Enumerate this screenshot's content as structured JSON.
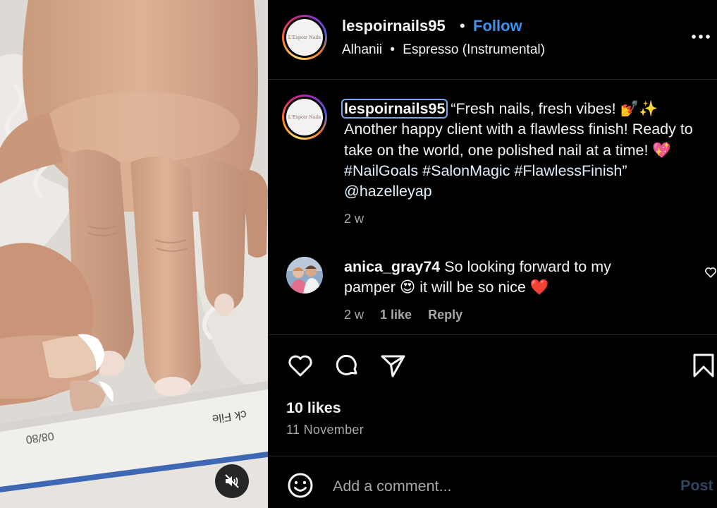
{
  "post": {
    "username": "lespoirnails95",
    "separator": "•",
    "follow_label": "Follow",
    "audio": {
      "artist": "Alhanii",
      "separator": "•",
      "track": "Espresso (Instrumental)"
    },
    "avatar_text": "L'Espoir Nails"
  },
  "media": {
    "file_text_1": "08/80",
    "file_text_2": "ck File",
    "mute_icon": "speaker-muted-icon"
  },
  "caption": {
    "username": "lespoirnails95",
    "text_1": "“Fresh nails, fresh vibes! 💅✨ Another happy client with a flawless finish! Ready to take on the world, one polished nail at a time! 💖 ",
    "hashtag_1": "#NailGoals",
    "hashtag_2": "#SalonMagic",
    "hashtag_3": "#FlawlessFinish",
    "text_2": "” ",
    "mention": "@hazelleyap",
    "time": "2 w"
  },
  "comment": {
    "username": "anica_gray74",
    "text": "So looking forward to my pamper 😍 it will be so nice ❤️",
    "time": "2 w",
    "likes": "1 like",
    "reply_label": "Reply"
  },
  "actions": {
    "icons": [
      "heart-icon",
      "comment-icon",
      "share-icon",
      "bookmark-icon"
    ]
  },
  "likes_label": "10 likes",
  "date_label": "11 November",
  "add_comment": {
    "placeholder": "Add a comment...",
    "post_label": "Post"
  },
  "colors": {
    "background": "#000000",
    "follow_blue": "#4192ef",
    "muted_text": "#a8a8a8",
    "post_disabled": "#32455e",
    "divider": "#262626"
  }
}
